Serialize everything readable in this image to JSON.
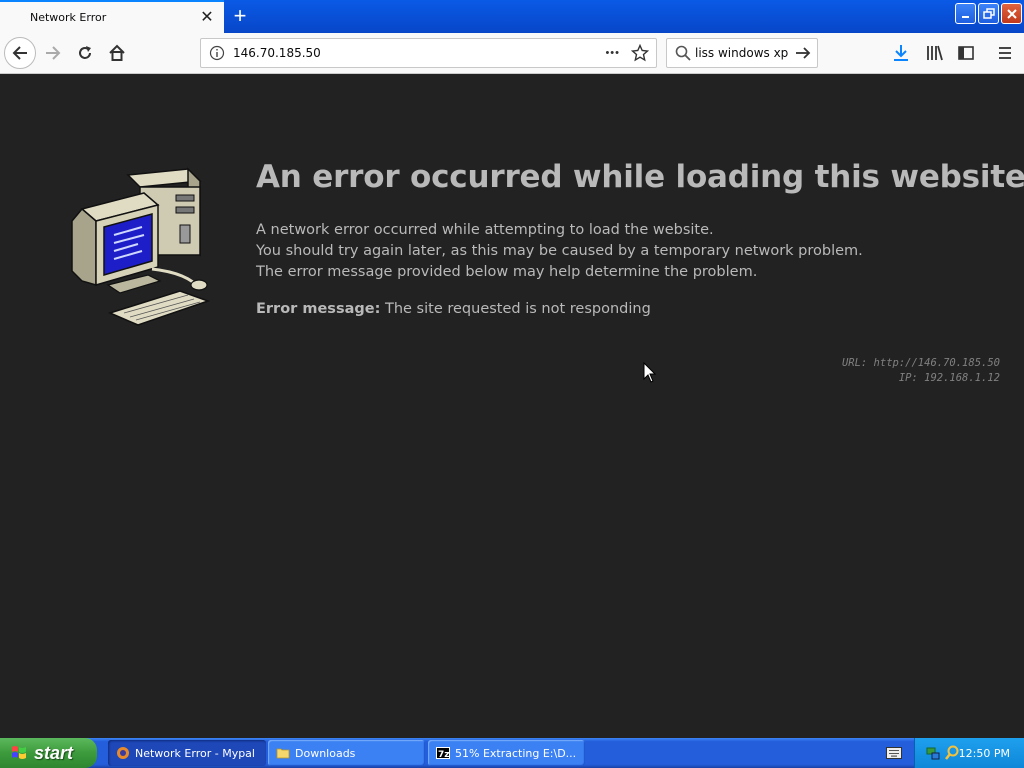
{
  "window": {
    "tab_title": "Network Error",
    "tab_close_glyph": "✕",
    "new_tab_glyph": "+"
  },
  "navbar": {
    "url": "146.70.185.50",
    "url_actions_glyph": "•••",
    "search_query": "liss windows xp"
  },
  "error_page": {
    "title": "An error occurred while loading this website",
    "lines": [
      "A network error occurred while attempting to load the website.",
      "You should try again later, as this may be caused by a temporary network problem.",
      "The error message provided below may help determine the problem."
    ],
    "message_label": "Error message:",
    "message_text": "The site requested is not responding",
    "url_info": "URL: http://146.70.185.50",
    "ip_info": "IP: 192.168.1.12"
  },
  "taskbar": {
    "start_label": "start",
    "items": [
      {
        "label": "Network Error - Mypal",
        "icon": "browser-icon"
      },
      {
        "label": "Downloads",
        "icon": "folder-icon"
      },
      {
        "label": "51% Extracting E:\\D...",
        "icon": "7zip-icon"
      }
    ],
    "clock": "12:50 PM"
  },
  "colors": {
    "titlebar_blue": "#0a5ae6",
    "content_bg": "#222223",
    "error_text": "#b9b9b9",
    "taskbar_blue": "#245edb",
    "start_green": "#3c9a3c"
  }
}
